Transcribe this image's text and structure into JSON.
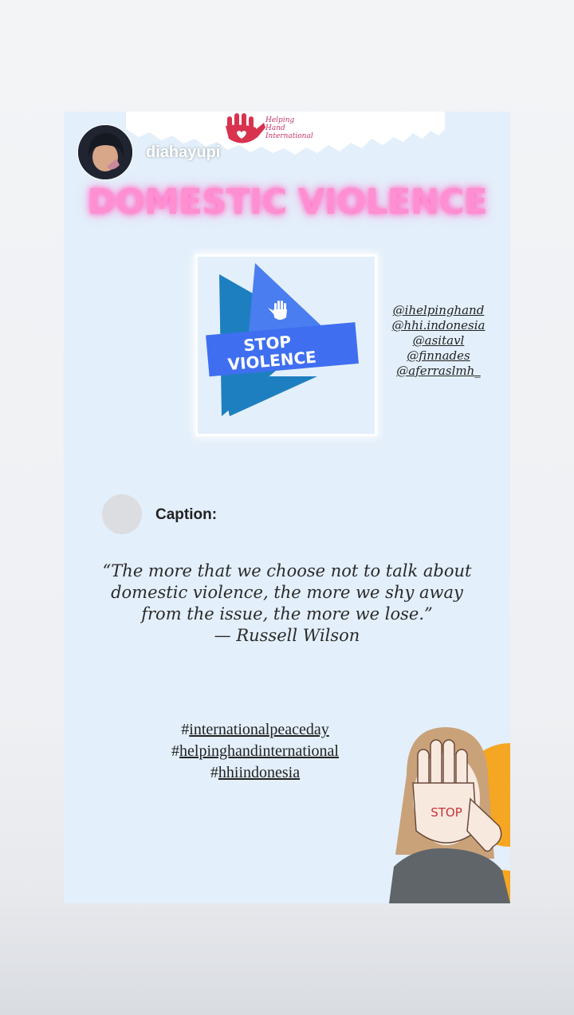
{
  "story": {
    "username": "diahayupi",
    "logo_text": [
      "Helping",
      "Hand",
      "International"
    ],
    "title": "DOMESTIC VIOLENCE",
    "graphic_text": [
      "STOP",
      "VIOLENCE"
    ],
    "mentions": [
      "@ihelpinghand",
      "@hhi.indonesia",
      "@asitavl",
      "@finnades",
      "@aferraslmh_"
    ],
    "caption_label": "Caption:",
    "quote_lines": [
      "“The more that we choose not to talk about",
      "domestic violence, the more we shy away",
      "from the issue, the more we lose.”",
      "— Russell Wilson"
    ],
    "hashtags": [
      "internationalpeaceday",
      "helpinghandinternational",
      "hhiindonesia"
    ],
    "illustration_text": "STOP"
  },
  "colors": {
    "background": "#e3effa",
    "title_glow": "#ff8fd1",
    "triangle_dark": "#1e7fc0",
    "triangle_light": "#4a7ef0",
    "banner": "#3f6ff0",
    "accent_orange": "#f5a623",
    "logo_red": "#d8324f"
  }
}
